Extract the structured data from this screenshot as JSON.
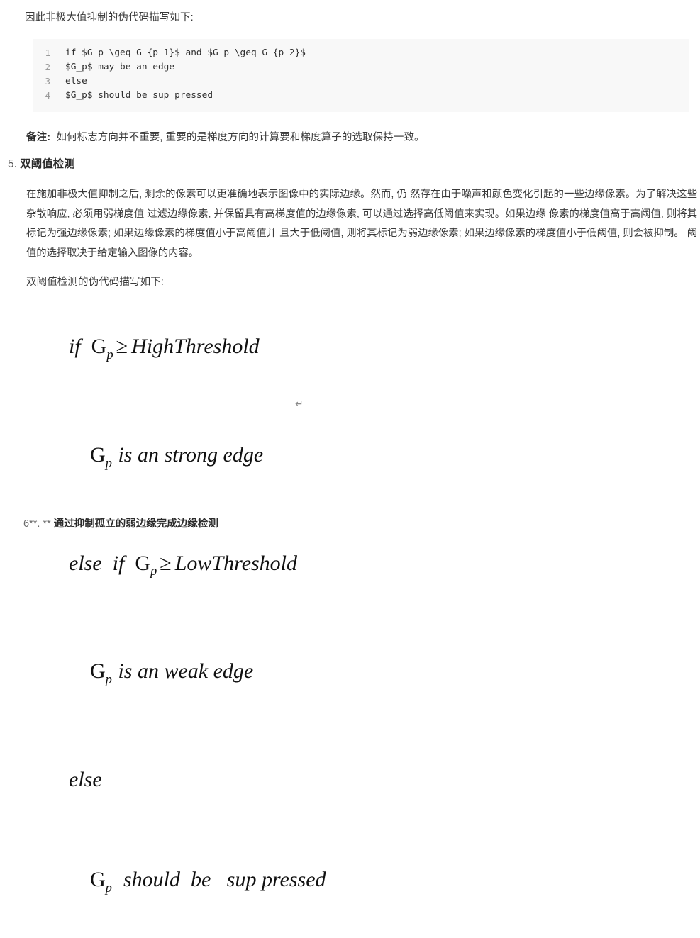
{
  "document": {
    "intro_line": "因此非极大值抑制的伪代码描写如下:",
    "code_block": {
      "lines": [
        {
          "number": "1",
          "text": "if $G_p \\geq G_{p 1}$ and $G_p \\geq G_{p 2}$"
        },
        {
          "number": "2",
          "text": "$G_p$ may be an edge"
        },
        {
          "number": "3",
          "text": "else"
        },
        {
          "number": "4",
          "text": "$G_p$ should be sup pressed"
        }
      ],
      "background": "#f8f8f8"
    },
    "note": {
      "label": "备注:",
      "text": "如何标志方向并不重要, 重要的是梯度方向的计算要和梯度算子的选取保持一致。"
    },
    "section_heading": {
      "number": "5.",
      "title": "双阈值检测"
    },
    "body_paragraph": "在施加非极大值抑制之后, 剩余的像素可以更准确地表示图像中的实际边缘。然而, 仍 然存在由于噪声和颜色变化引起的一些边缘像素。为了解决这些杂散响应, 必须用弱梯度值 过滤边缘像素, 并保留具有高梯度值的边缘像素, 可以通过选择高低阈值来实现。如果边缘 像素的梯度值高于高阈值, 则将其标记为强边缘像素; 如果边缘像素的梯度值小于高阈值并 且大于低阈值, 则将其标记为弱边缘像素; 如果边缘像素的梯度值小于低阈值, 则会被抑制。 阈值的选择取决于给定输入图像的内容。",
    "lead_line": "双阈值检测的伪代码描写如下:",
    "equation": {
      "line1": {
        "keyword": "if",
        "var": "G",
        "subscript": "p",
        "operator": "≥",
        "expr": "HighThreshold"
      },
      "line2": {
        "var": "G",
        "subscript": "p",
        "text": "is an strong edge"
      },
      "line3": {
        "keyword": "else  if",
        "var": "G",
        "subscript": "p",
        "operator": "≥",
        "expr": "LowThreshold"
      },
      "line4": {
        "var": "G",
        "subscript": "p",
        "text": "is an weak edge"
      },
      "line5": {
        "keyword": "else"
      },
      "line6": {
        "var": "G",
        "subscript": "p",
        "text": "should  be   sup pressed"
      }
    },
    "return_mark": "↵",
    "footer_heading": {
      "prefix": "6**. **",
      "title": "通过抑制孤立的弱边缘完成边缘检测"
    }
  }
}
